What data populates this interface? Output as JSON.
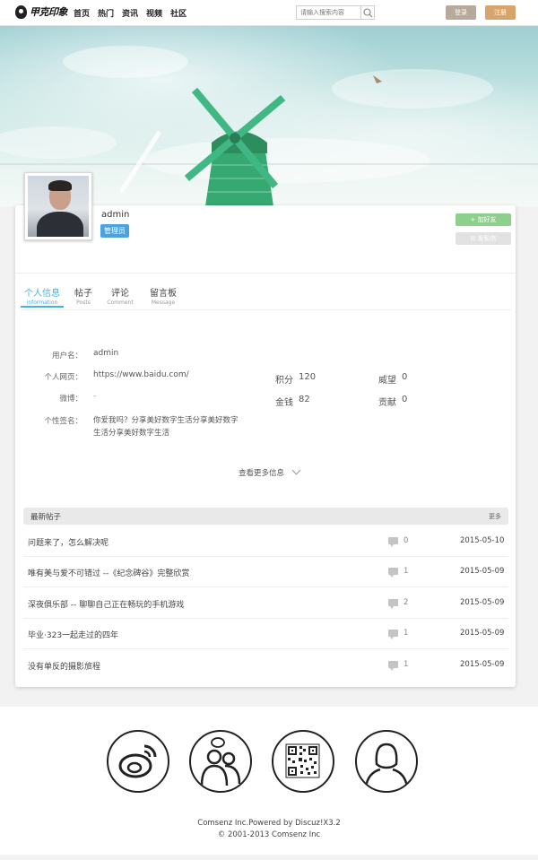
{
  "header": {
    "logo_text": "甲克印象",
    "nav": [
      "首页",
      "热门",
      "资讯",
      "视频",
      "社区"
    ],
    "search_placeholder": "请输入搜索内容",
    "login_label": "登录",
    "register_label": "注册"
  },
  "profile": {
    "username": "admin",
    "role_badge": "管理员",
    "add_friend_label": "+ 加好友",
    "message_label": "发私信"
  },
  "tabs": [
    {
      "cn": "个人信息",
      "en": "information"
    },
    {
      "cn": "帖子",
      "en": "Posts"
    },
    {
      "cn": "评论",
      "en": "Comment"
    },
    {
      "cn": "留言板",
      "en": "Message"
    }
  ],
  "info": {
    "username_label": "用户名：",
    "username_value": "admin",
    "homepage_label": "个人网页：",
    "homepage_value": "https://www.baidu.com/",
    "weibo_label": "微博：",
    "weibo_value": "-",
    "signature_label": "个性签名：",
    "signature_line1": "你爱我吗？分享美好数字生活分享美好数字",
    "signature_line2": "生活分享美好数字生活"
  },
  "stats": {
    "points_label": "积分",
    "points_value": "120",
    "prestige_label": "威望",
    "prestige_value": "0",
    "money_label": "金钱",
    "money_value": "82",
    "contribution_label": "贡献",
    "contribution_value": "0"
  },
  "more_info_label": "查看更多信息",
  "recent_posts": {
    "title": "最新帖子",
    "more_label": "更多",
    "items": [
      {
        "title": "问题来了，怎么解决呢",
        "comments": "0",
        "date": "2015-05-10"
      },
      {
        "title": "唯有美与爱不可错过 --《纪念碑谷》完整欣赏",
        "comments": "1",
        "date": "2015-05-09"
      },
      {
        "title": "深夜俱乐部 -- 聊聊自己正在畅玩的手机游戏",
        "comments": "2",
        "date": "2015-05-09"
      },
      {
        "title": "毕业·323一起走过的四年",
        "comments": "1",
        "date": "2015-05-09"
      },
      {
        "title": "没有单反的摄影旅程",
        "comments": "1",
        "date": "2015-05-09"
      }
    ]
  },
  "footer": {
    "icons": [
      "weibo-icon",
      "group-chat-icon",
      "qrcode-icon",
      "user-icon"
    ],
    "powered": "Comsenz Inc.Powered by Discuz!X3.2",
    "copyright": "© 2001-2013 Comsenz Inc"
  },
  "colors": {
    "accent_blue": "#4ab0d6",
    "badge_blue": "#4aa3df",
    "friend_green": "#8dd08c",
    "login_btn": "#b7aa9a",
    "register_btn": "#d7a56a"
  }
}
